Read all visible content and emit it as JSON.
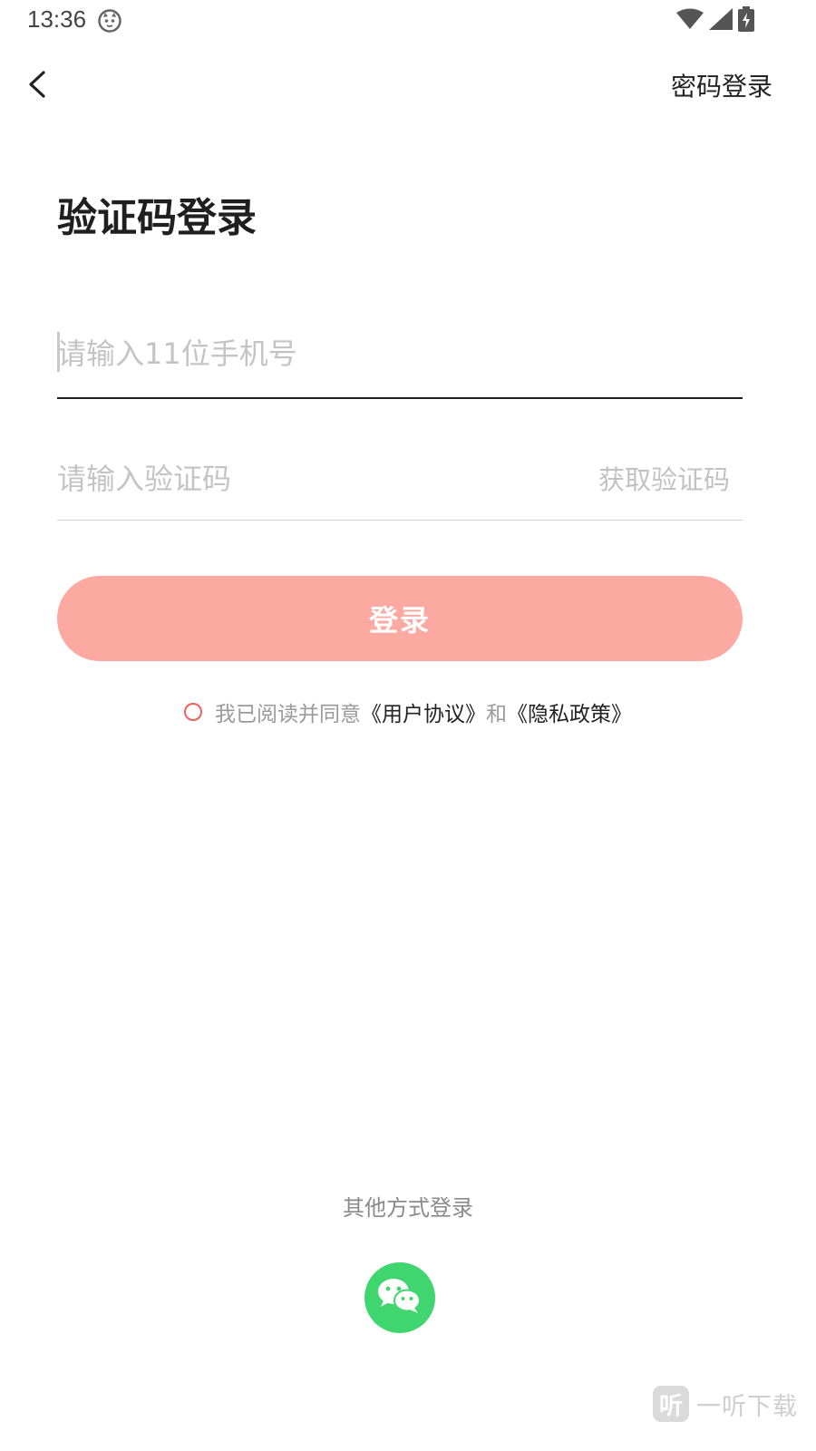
{
  "status_bar": {
    "time": "13:36"
  },
  "header": {
    "back_icon": "chevron-left-icon",
    "switch_label": "密码登录"
  },
  "form": {
    "title": "验证码登录",
    "phone_placeholder": "请输入11位手机号",
    "code_placeholder": "请输入验证码",
    "get_code_label": "获取验证码",
    "login_label": "登录"
  },
  "agreement": {
    "prefix": "我已阅读并同意",
    "user_agreement": "《用户协议》",
    "conjunction": "和",
    "privacy_policy": "《隐私政策》"
  },
  "other_login": {
    "label": "其他方式登录",
    "wechat_icon": "wechat-icon"
  },
  "watermark": {
    "logo": "听",
    "text": "一听下载"
  },
  "colors": {
    "login_button": "#fca9a1",
    "checkbox_border": "#f0605a",
    "wechat": "#3fd66f"
  }
}
